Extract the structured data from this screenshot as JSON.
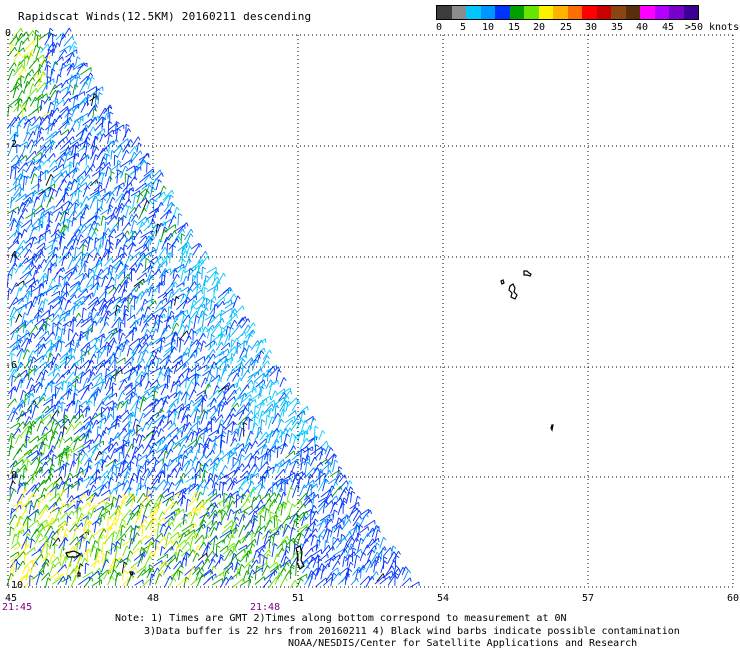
{
  "title": "Rapidscat Winds(12.5KM) 20160211 descending",
  "legend": {
    "labels": [
      "0",
      "5",
      "10",
      "15",
      "20",
      "25",
      "30",
      "35",
      "40",
      "45",
      ">50 knots"
    ],
    "colors": [
      "#3c3c3c",
      "#8c8c8c",
      "#00c8ff",
      "#0096ff",
      "#0032ff",
      "#00a000",
      "#64e600",
      "#fff000",
      "#ffb400",
      "#ff6e00",
      "#ff0000",
      "#c80000",
      "#8b4513",
      "#5a2d0c",
      "#ff00ff",
      "#b400ff",
      "#7800c8",
      "#3c0096"
    ]
  },
  "map": {
    "y_labels": [
      "0",
      "-2",
      "-4",
      "-6",
      "-8",
      "-10"
    ],
    "x_labels": [
      "45",
      "48",
      "51",
      "54",
      "57",
      "60"
    ],
    "time_labels": [
      "21:45",
      "21:48"
    ],
    "colors": {
      "grid": "#000000",
      "time": "#800080",
      "coast": "#000000"
    }
  },
  "notes": {
    "line1": "Note: 1) Times are GMT 2)Times along bottom correspond to measurement at 0N",
    "line2": "3)Data buffer is 22 hrs from 20160211 4) Black wind barbs indicate possible contamination",
    "line3": "NOAA/NESDIS/Center for Satellite Applications and Research"
  }
}
